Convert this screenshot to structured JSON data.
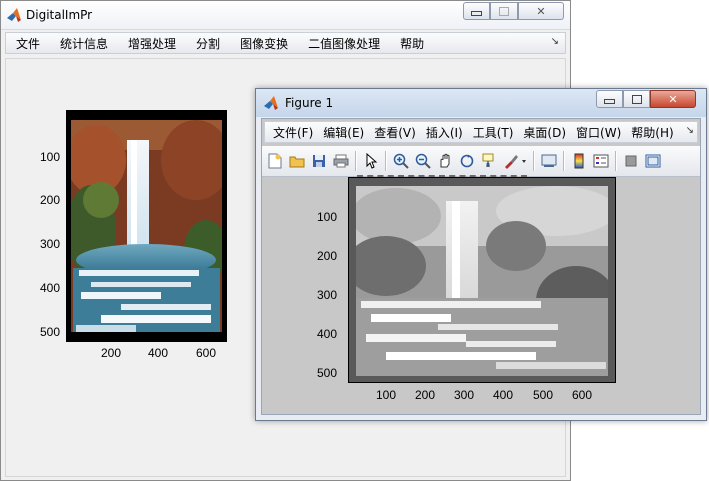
{
  "main_window": {
    "title": "DigitalImPr",
    "menu": [
      "文件",
      "统计信息",
      "增强处理",
      "分割",
      "图像变换",
      "二值图像处理",
      "帮助"
    ],
    "menu_overflow_icon": "chevron-double-right-icon",
    "axes": {
      "y_ticks": [
        "100",
        "200",
        "300",
        "400",
        "500"
      ],
      "x_ticks": [
        "200",
        "400",
        "600"
      ]
    }
  },
  "figure_window": {
    "title": "Figure 1",
    "menu": [
      "文件(F)",
      "编辑(E)",
      "查看(V)",
      "插入(I)",
      "工具(T)",
      "桌面(D)",
      "窗口(W)",
      "帮助(H)"
    ],
    "menu_overflow_icon": "chevron-double-right-icon",
    "toolbar_icons": [
      "new-figure-icon",
      "open-file-icon",
      "save-icon",
      "print-icon",
      "pointer-icon",
      "zoom-in-icon",
      "zoom-out-icon",
      "pan-hand-icon",
      "rotate-3d-icon",
      "data-cursor-icon",
      "brush-icon",
      "link-plot-icon",
      "colorbar-icon",
      "legend-icon",
      "hide-tools-icon",
      "show-tools-icon"
    ],
    "axes": {
      "y_ticks": [
        "100",
        "200",
        "300",
        "400",
        "500"
      ],
      "x_ticks": [
        "100",
        "200",
        "300",
        "400",
        "500",
        "600"
      ]
    }
  },
  "colors": {
    "window_bg": "#f0f0f0",
    "figure_bg": "#c8c8c8",
    "close_button": "#c8472e"
  }
}
